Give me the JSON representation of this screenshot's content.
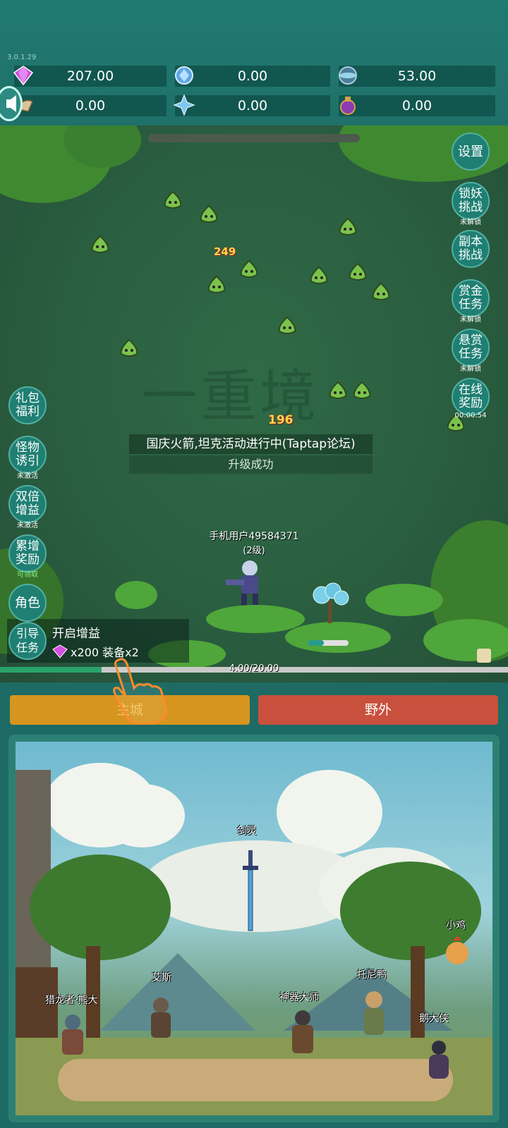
{
  "version_label": "3.0.1.29",
  "resources": [
    {
      "icon": "purple-gem-icon",
      "value": "207.00"
    },
    {
      "icon": "blue-crystal-icon",
      "value": "0.00"
    },
    {
      "icon": "orb-icon",
      "value": "53.00"
    },
    {
      "icon": "horn-icon",
      "value": "0.00"
    },
    {
      "icon": "ice-shard-icon",
      "value": "0.00"
    },
    {
      "icon": "potion-icon",
      "value": "0.00"
    }
  ],
  "battle": {
    "watermark": "一重境",
    "damage_numbers": [
      "249",
      "196"
    ],
    "notice": "国庆火箭,坦克活动进行中(Taptap论坛)",
    "level_up": "升级成功",
    "player_name": "手机用户49584371",
    "player_level": "(2级)"
  },
  "right_buttons": [
    {
      "label": "设置",
      "sub": ""
    },
    {
      "label": "锁妖挑战",
      "sub": "未解锁"
    },
    {
      "label": "副本挑战",
      "sub": ""
    },
    {
      "label": "赏金任务",
      "sub": "未解锁"
    },
    {
      "label": "悬赏任务",
      "sub": "未解锁"
    },
    {
      "label": "在线奖励",
      "sub": "00:00:54"
    }
  ],
  "left_buttons": [
    {
      "label": "礼包福利",
      "sub": ""
    },
    {
      "label": "怪物诱引",
      "sub": "未激活"
    },
    {
      "label": "双倍增益",
      "sub": "未激活"
    },
    {
      "label": "累增奖励",
      "sub": "可领取"
    },
    {
      "label": "角色",
      "sub": ""
    }
  ],
  "guide": {
    "button_label": "引导任务",
    "title": "开启增益",
    "reward": "x200 装备x2"
  },
  "xp": {
    "text": "4.00/20.00",
    "fraction": 0.2
  },
  "main_buttons": {
    "city": "主城",
    "wild": "野外"
  },
  "npcs": [
    "剑灵",
    "小鸡",
    "艾斯",
    "托尼鸭",
    "猎龙者·熊大",
    "神器大师",
    "鹅大侠"
  ],
  "colors": {
    "city_button": "#d6951e",
    "wild_button": "#c9503c",
    "resource_bar": "#11574f"
  }
}
